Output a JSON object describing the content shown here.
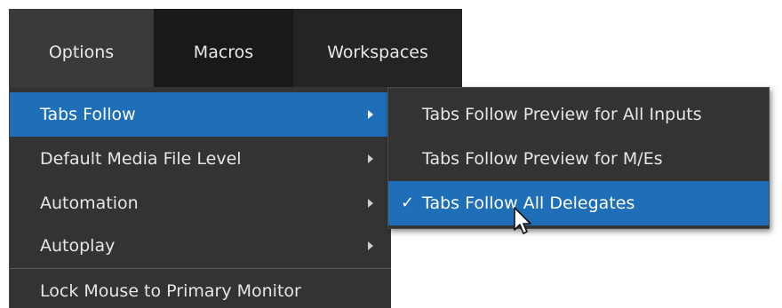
{
  "menubar": {
    "items": [
      {
        "label": "Options"
      },
      {
        "label": "Macros"
      },
      {
        "label": "Workspaces"
      }
    ]
  },
  "options_menu": {
    "items": [
      {
        "label": "Tabs Follow",
        "has_submenu": true,
        "highlighted": true
      },
      {
        "label": "Default Media File Level",
        "has_submenu": true
      },
      {
        "label": "Automation",
        "has_submenu": true
      },
      {
        "label": "Autoplay",
        "has_submenu": true
      },
      {
        "label": "Lock Mouse to Primary Monitor",
        "has_submenu": false
      }
    ]
  },
  "tabs_follow_submenu": {
    "items": [
      {
        "label": "Tabs Follow Preview for All Inputs",
        "checked": false
      },
      {
        "label": "Tabs Follow Preview for M/Es",
        "checked": false
      },
      {
        "label": "Tabs Follow All Delegates",
        "checked": true,
        "highlighted": true
      }
    ],
    "check_glyph": "✓"
  },
  "colors": {
    "menu_bg": "#333333",
    "highlight": "#1e6fb8",
    "menubar_bg": "#242424"
  }
}
